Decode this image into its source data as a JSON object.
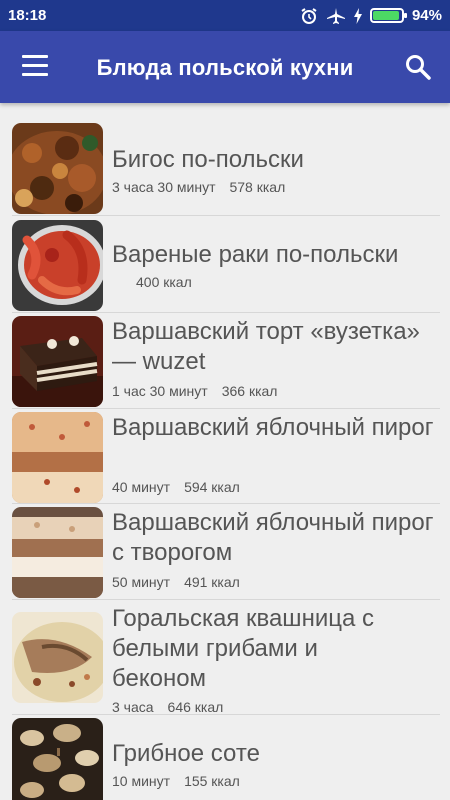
{
  "status": {
    "time": "18:18",
    "battery": "94%",
    "battery_level": 0.94
  },
  "appbar": {
    "title": "Блюда польской кухни",
    "menu_icon": "menu-icon",
    "search_icon": "search-icon"
  },
  "recipes": [
    {
      "name": "Бигос по-польски",
      "time": "3 часа 30 минут",
      "kcal": "578 ккал"
    },
    {
      "name": "Вареные раки по-польски",
      "time": "",
      "kcal": "400 ккал"
    },
    {
      "name": "Варшавский торт «вузетка» — wuzet",
      "time": "1 час 30 минут",
      "kcal": "366 ккал"
    },
    {
      "name": "Варшавский яблочный пирог",
      "time": "40 минут",
      "kcal": "594 ккал"
    },
    {
      "name": "Варшавский яблочный пирог с творогом",
      "time": "50 минут",
      "kcal": "491 ккал"
    },
    {
      "name": "Горальская квашница с белыми грибами и беконом",
      "time": "3 часа",
      "kcal": "646 ккал"
    },
    {
      "name": "Грибное соте",
      "time": "10 минут",
      "kcal": "155 ккал"
    }
  ]
}
